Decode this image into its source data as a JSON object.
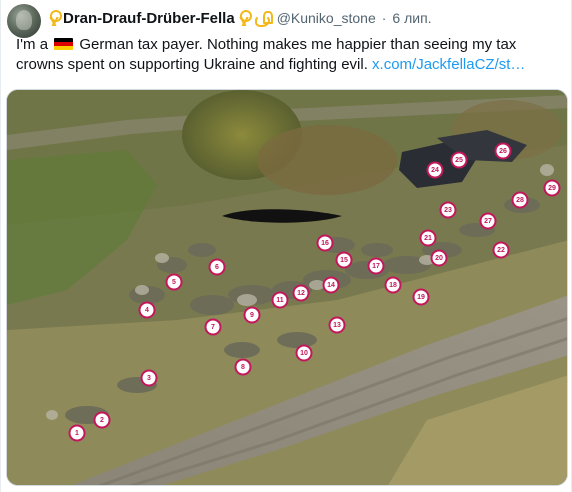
{
  "tweet": {
    "display_name": "Dran-Drauf-Drüber-Fella",
    "handle": "@Kuniko_stone",
    "separator": "·",
    "date": "6 лип.",
    "text_part1": "I'm a",
    "text_part2": "German tax payer. Nothing makes me happier than seeing my tax crowns spent on supporting Ukraine and fighting evil.",
    "link": "x.com/JackfellaCZ/st…",
    "icons": {
      "avatar": "avatar",
      "name_badge_1": "yellow-ribbon-icon",
      "name_badge_2": "yellow-ribbon-icon",
      "name_badge_3": "bicep-icon",
      "flag": "german-flag-icon"
    },
    "colors": {
      "link": "#1d9bf0",
      "secondary_text": "#536471",
      "marker": "#c2185b",
      "ribbon": "#f2b81c"
    }
  },
  "media": {
    "description_type": "aerial-photo",
    "markers": [
      {
        "label": "1"
      },
      {
        "label": "2"
      },
      {
        "label": "3"
      },
      {
        "label": "4"
      },
      {
        "label": "5"
      },
      {
        "label": "6"
      },
      {
        "label": "7"
      },
      {
        "label": "8"
      },
      {
        "label": "9"
      },
      {
        "label": "10"
      },
      {
        "label": "11"
      },
      {
        "label": "12"
      },
      {
        "label": "13"
      },
      {
        "label": "14"
      },
      {
        "label": "15"
      },
      {
        "label": "16"
      },
      {
        "label": "17"
      },
      {
        "label": "18"
      },
      {
        "label": "19"
      },
      {
        "label": "20"
      },
      {
        "label": "21"
      },
      {
        "label": "22"
      },
      {
        "label": "23"
      },
      {
        "label": "24"
      },
      {
        "label": "25"
      },
      {
        "label": "26"
      },
      {
        "label": "27"
      },
      {
        "label": "28"
      },
      {
        "label": "29"
      }
    ]
  }
}
